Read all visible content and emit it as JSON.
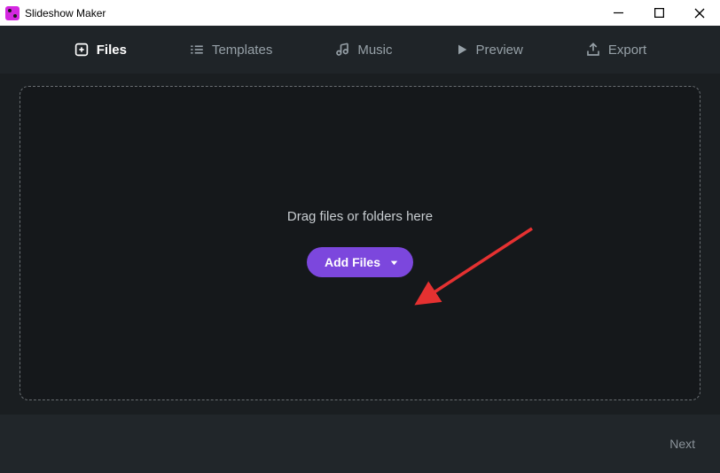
{
  "titlebar": {
    "title": "Slideshow Maker"
  },
  "tabs": {
    "files": "Files",
    "templates": "Templates",
    "music": "Music",
    "preview": "Preview",
    "export": "Export"
  },
  "dropzone": {
    "hint": "Drag files or folders here",
    "button_label": "Add Files"
  },
  "footer": {
    "next": "Next"
  }
}
